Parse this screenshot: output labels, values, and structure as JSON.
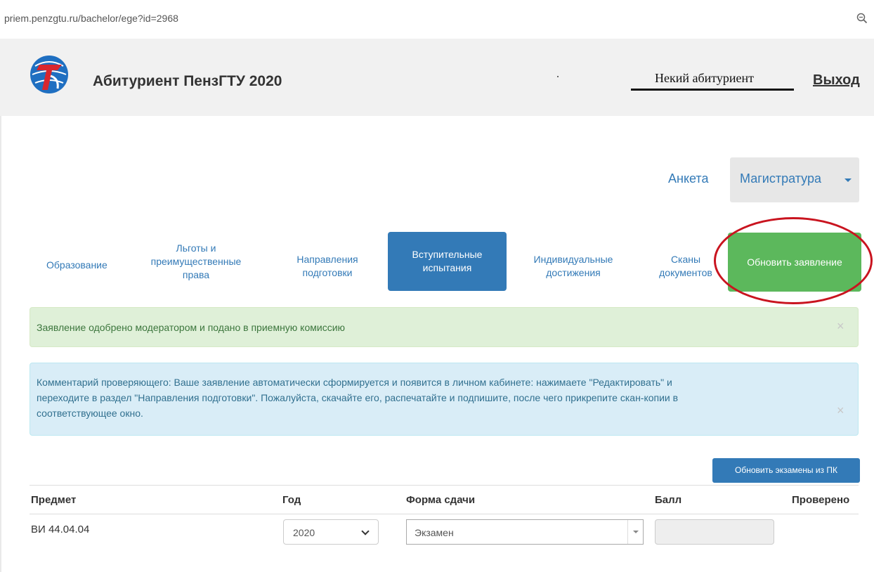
{
  "url": "priem.penzgtu.ru/bachelor/ege?id=2968",
  "header": {
    "brand": "Абитуриент ПензГТУ 2020",
    "username": "Некий абитуриент",
    "logout": "Выход"
  },
  "topnav": {
    "anketa": "Анкета",
    "magistratura": "Магистратура"
  },
  "tabs": {
    "education": "Образование",
    "benefits_1": "Льготы и",
    "benefits_2": "преимущественные",
    "benefits_3": "права",
    "directions_1": "Направления",
    "directions_2": "подготовки",
    "exams_1": "Вступительные",
    "exams_2": "испытания",
    "achievements_1": "Индивидуальные",
    "achievements_2": "достижения",
    "scans_1": "Сканы",
    "scans_2": "документов",
    "update": "Обновить заявление"
  },
  "alerts": {
    "success": "Заявление одобрено модератором и подано в приемную комиссию",
    "info_1": "Комментарий проверяющего: Ваше заявление автоматически сформируется и появится в личном кабинете: нажимаете \"Редактировать\" и",
    "info_2": "переходите в раздел \"Направления подготовки\". Пожалуйста, скачайте его, распечатайте и подпишите, после чего прикрепите скан-копии в",
    "info_3": "соответствующее окно.",
    "close": "×"
  },
  "table": {
    "sync_button": "Обновить экзамены из ПК",
    "headers": {
      "subject": "Предмет",
      "year": "Год",
      "form": "Форма сдачи",
      "score": "Балл",
      "checked": "Проверено"
    },
    "rows": [
      {
        "subject": "ВИ 44.04.04",
        "year": "2020",
        "form": "Экзамен",
        "score": ""
      }
    ]
  },
  "colors": {
    "primary": "#337ab7",
    "success_button": "#5cb85c",
    "highlight_circle": "#c9141f"
  }
}
